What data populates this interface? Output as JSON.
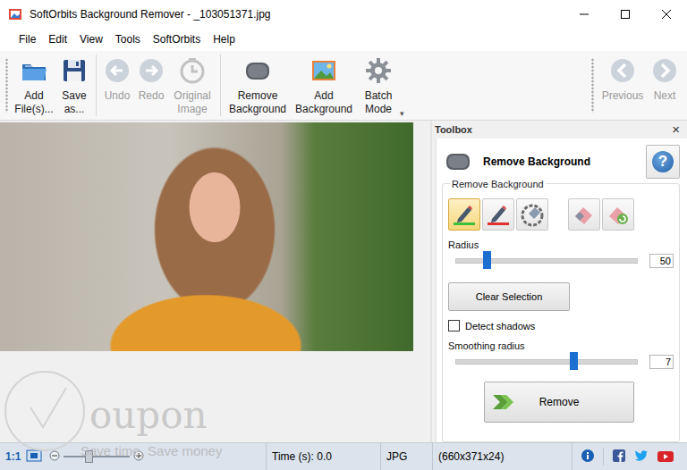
{
  "window": {
    "title": "SoftOrbits Background Remover - _103051371.jpg"
  },
  "menu": [
    "File",
    "Edit",
    "View",
    "Tools",
    "SoftOrbits",
    "Help"
  ],
  "toolbar": {
    "left": [
      {
        "label": "Add File(s)...",
        "kind": "add-files",
        "disabled": false
      },
      {
        "label": "Save as...",
        "kind": "save",
        "disabled": false
      },
      {
        "label": "Undo",
        "kind": "undo",
        "disabled": true
      },
      {
        "label": "Redo",
        "kind": "redo",
        "disabled": true
      },
      {
        "label": "Original Image",
        "kind": "original",
        "disabled": true
      },
      {
        "label": "Remove Background",
        "kind": "remove-bg",
        "disabled": false
      },
      {
        "label": "Add Background",
        "kind": "add-bg",
        "disabled": false
      },
      {
        "label": "Batch Mode",
        "kind": "batch",
        "disabled": false
      }
    ],
    "more": "▾",
    "right": [
      {
        "label": "Previous",
        "kind": "previous",
        "disabled": true
      },
      {
        "label": "Next",
        "kind": "next",
        "disabled": true
      }
    ]
  },
  "watermark": {
    "logo": "oupon",
    "slogan": "Save time, Save money"
  },
  "toolbox": {
    "title": "Toolbox",
    "close": "×",
    "panel_title": "Remove Background",
    "help": "?",
    "group_label": "Remove Background",
    "tools": [
      {
        "kind": "keep",
        "selected": true
      },
      {
        "kind": "remove",
        "selected": false
      },
      {
        "kind": "eraser",
        "selected": false
      },
      {
        "kind": "clear-marks",
        "selected": false
      },
      {
        "kind": "reset",
        "selected": false
      }
    ],
    "radius": {
      "label": "Radius",
      "level": 0.17,
      "value": "50"
    },
    "clear_button": "Clear Selection",
    "detect_shadows": {
      "label": "Detect shadows",
      "checked": false
    },
    "smoothing": {
      "label": "Smoothing radius",
      "level": 0.65,
      "value": "7"
    },
    "remove_button": "Remove"
  },
  "status_bar": {
    "zoom": "1:1",
    "zoom_level": 0.38,
    "time": "Time (s): 0.0",
    "format": "JPG",
    "dimensions": "(660x371x24)"
  }
}
